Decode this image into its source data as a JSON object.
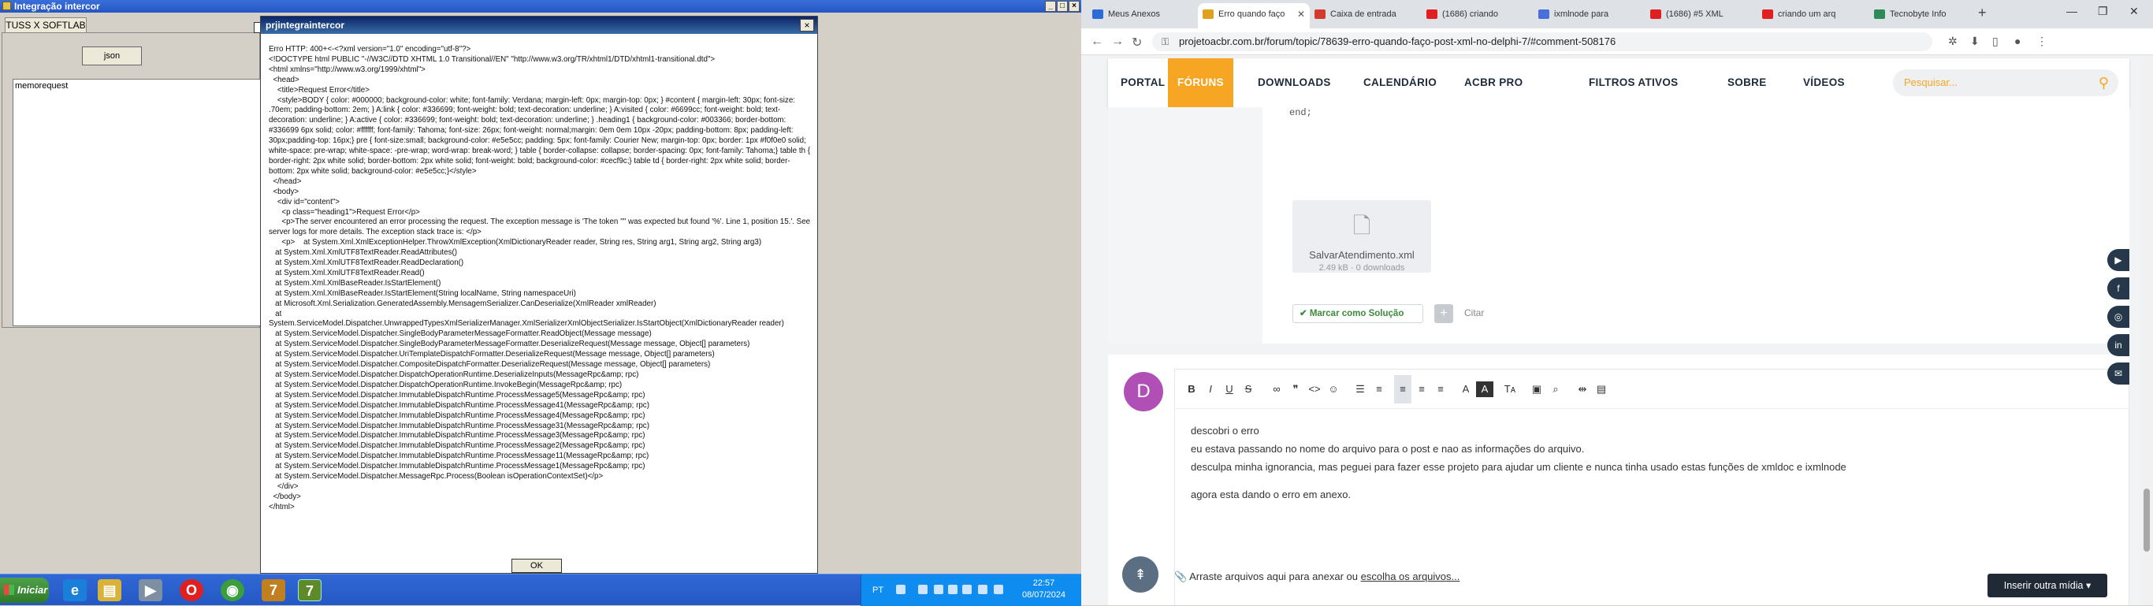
{
  "app": {
    "title": "Integração intercor",
    "tab": "TUSS X SOFTLAB",
    "json_button": "json",
    "memo_text": "memorequest",
    "title_controls": [
      "_",
      "□",
      "×"
    ]
  },
  "dialog": {
    "title": "prjintegraintercor",
    "close": "×",
    "ok": "OK",
    "body": "Erro HTTP: 400+<-<?xml version=\"1.0\" encoding=\"utf-8\"?>\n<!DOCTYPE html PUBLIC \"-//W3C//DTD XHTML 1.0 Transitional//EN\" \"http://www.w3.org/TR/xhtml1/DTD/xhtml1-transitional.dtd\">\n<html xmlns=\"http://www.w3.org/1999/xhtml\">\n  <head>\n    <title>Request Error</title>\n    <style>BODY { color: #000000; background-color: white; font-family: Verdana; margin-left: 0px; margin-top: 0px; } #content { margin-left: 30px; font-size: .70em; padding-bottom: 2em; } A:link { color: #336699; font-weight: bold; text-decoration: underline; } A:visited { color: #6699cc; font-weight: bold; text-decoration: underline; } A:active { color: #336699; font-weight: bold; text-decoration: underline; } .heading1 { background-color: #003366; border-bottom: #336699 6px solid; color: #ffffff; font-family: Tahoma; font-size: 26px; font-weight: normal;margin: 0em 0em 10px -20px; padding-bottom: 8px; padding-left: 30px;padding-top: 16px;} pre { font-size:small; background-color: #e5e5cc; padding: 5px; font-family: Courier New; margin-top: 0px; border: 1px #f0f0e0 solid; white-space: pre-wrap; white-space: -pre-wrap; word-wrap: break-word; } table { border-collapse: collapse; border-spacing: 0px; font-family: Tahoma;} table th { border-right: 2px white solid; border-bottom: 2px white solid; font-weight: bold; background-color: #cecf9c;} table td { border-right: 2px white solid; border-bottom: 2px white solid; background-color: #e5e5cc;}</style>\n  </head>\n  <body>\n    <div id=\"content\">\n      <p class=\"heading1\">Request Error</p>\n      <p>The server encountered an error processing the request. The exception message is 'The token '\"' was expected but found '%'. Line 1, position 15.'. See server logs for more details. The exception stack trace is: </p>\n      <p>    at System.Xml.XmlExceptionHelper.ThrowXmlException(XmlDictionaryReader reader, String res, String arg1, String arg2, String arg3)\n   at System.Xml.XmlUTF8TextReader.ReadAttributes()\n   at System.Xml.XmlUTF8TextReader.ReadDeclaration()\n   at System.Xml.XmlUTF8TextReader.Read()\n   at System.Xml.XmlBaseReader.IsStartElement()\n   at System.Xml.XmlBaseReader.IsStartElement(String localName, String namespaceUri)\n   at Microsoft.Xml.Serialization.GeneratedAssembly.MensagemSerializer.CanDeserialize(XmlReader xmlReader)\n   at\nSystem.ServiceModel.Dispatcher.UnwrappedTypesXmlSerializerManager.XmlSerializerXmlObjectSerializer.IsStartObject(XmlDictionaryReader reader)\n   at System.ServiceModel.Dispatcher.SingleBodyParameterMessageFormatter.ReadObject(Message message)\n   at System.ServiceModel.Dispatcher.SingleBodyParameterMessageFormatter.DeserializeRequest(Message message, Object[] parameters)\n   at System.ServiceModel.Dispatcher.UriTemplateDispatchFormatter.DeserializeRequest(Message message, Object[] parameters)\n   at System.ServiceModel.Dispatcher.CompositeDispatchFormatter.DeserializeRequest(Message message, Object[] parameters)\n   at System.ServiceModel.Dispatcher.DispatchOperationRuntime.DeserializeInputs(MessageRpc&amp; rpc)\n   at System.ServiceModel.Dispatcher.DispatchOperationRuntime.InvokeBegin(MessageRpc&amp; rpc)\n   at System.ServiceModel.Dispatcher.ImmutableDispatchRuntime.ProcessMessage5(MessageRpc&amp; rpc)\n   at System.ServiceModel.Dispatcher.ImmutableDispatchRuntime.ProcessMessage41(MessageRpc&amp; rpc)\n   at System.ServiceModel.Dispatcher.ImmutableDispatchRuntime.ProcessMessage4(MessageRpc&amp; rpc)\n   at System.ServiceModel.Dispatcher.ImmutableDispatchRuntime.ProcessMessage31(MessageRpc&amp; rpc)\n   at System.ServiceModel.Dispatcher.ImmutableDispatchRuntime.ProcessMessage3(MessageRpc&amp; rpc)\n   at System.ServiceModel.Dispatcher.ImmutableDispatchRuntime.ProcessMessage2(MessageRpc&amp; rpc)\n   at System.ServiceModel.Dispatcher.ImmutableDispatchRuntime.ProcessMessage11(MessageRpc&amp; rpc)\n   at System.ServiceModel.Dispatcher.ImmutableDispatchRuntime.ProcessMessage1(MessageRpc&amp; rpc)\n   at System.ServiceModel.Dispatcher.MessageRpc.Process(Boolean isOperationContextSet)</p>\n    </div>\n  </body>\n</html>"
  },
  "taskbar": {
    "start": "Iniciar",
    "lang": "PT",
    "time": "22:57",
    "date": "08/07/2024"
  },
  "browser": {
    "tabs": [
      {
        "label": "Meus Anexos",
        "color": "#2b6cd6"
      },
      {
        "label": "Erro quando faço",
        "color": "#e0a020"
      },
      {
        "label": "Caixa de entrada",
        "color": "#d33b2c"
      },
      {
        "label": "(1686) criando",
        "color": "#e02020"
      },
      {
        "label": "ixmlnode para",
        "color": "#4a6fd8"
      },
      {
        "label": "(1686) #5 XML",
        "color": "#e02020"
      },
      {
        "label": "criando um arq",
        "color": "#e02020"
      },
      {
        "label": "Tecnobyte Info",
        "color": "#2e8b57"
      }
    ],
    "url": "projetoacbr.com.br/forum/topic/78639-erro-quando-faço-post-xml-no-delphi-7/#comment-508176"
  },
  "site": {
    "nav": [
      "PORTAL",
      "FÓRUNS",
      "DOWNLOADS",
      "CALENDÁRIO",
      "ACBR PRO",
      "FILTROS ATIVOS",
      "SOBRE",
      "VÍDEOS"
    ],
    "search_placeholder": "Pesquisar...",
    "code_fragment": "end;",
    "attachment": {
      "name": "SalvarAtendimento.xml",
      "meta": "2.49 kB · 0 downloads"
    },
    "solution_button": "✔ Marcar como Solução",
    "cite": "Citar",
    "avatar_letter": "D",
    "reply_lines": [
      "descobri o erro",
      "eu estava passando no nome do arquivo para o post e nao as informações do arquivo.",
      "desculpa minha ignorancia, mas peguei para fazer esse projeto para ajudar um cliente e nunca tinha usado estas funções de xmldoc e ixmlnode",
      "",
      "agora esta dando o erro em anexo."
    ],
    "attach_prompt": "Arraste arquivos aqui para anexar ou",
    "attach_link": "escolha os arquivos...",
    "insert_button": "Inserir outra mídia ▾"
  }
}
